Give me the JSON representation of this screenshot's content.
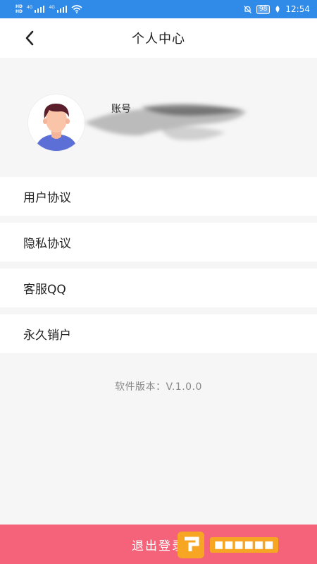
{
  "status_bar": {
    "sim_labels": [
      "HD",
      "HD"
    ],
    "network_tags": [
      "4G",
      "4G"
    ],
    "battery": "98",
    "time": "12:54"
  },
  "nav": {
    "title": "个人中心"
  },
  "profile": {
    "account_label": "账号"
  },
  "menu": [
    {
      "label": "用户协议"
    },
    {
      "label": "隐私协议"
    },
    {
      "label": "客服QQ"
    },
    {
      "label": "永久销户"
    }
  ],
  "version": "软件版本：V.1.0.0",
  "logout": {
    "label": "退出登录"
  },
  "colors": {
    "status_bar": "#2f8ae8",
    "logout_button": "#f5637a",
    "watermark": "#f6a623"
  },
  "icons": [
    "back-arrow-icon",
    "wifi-icon",
    "mute-icon",
    "battery-icon",
    "leaf-icon",
    "avatar-illustration"
  ]
}
